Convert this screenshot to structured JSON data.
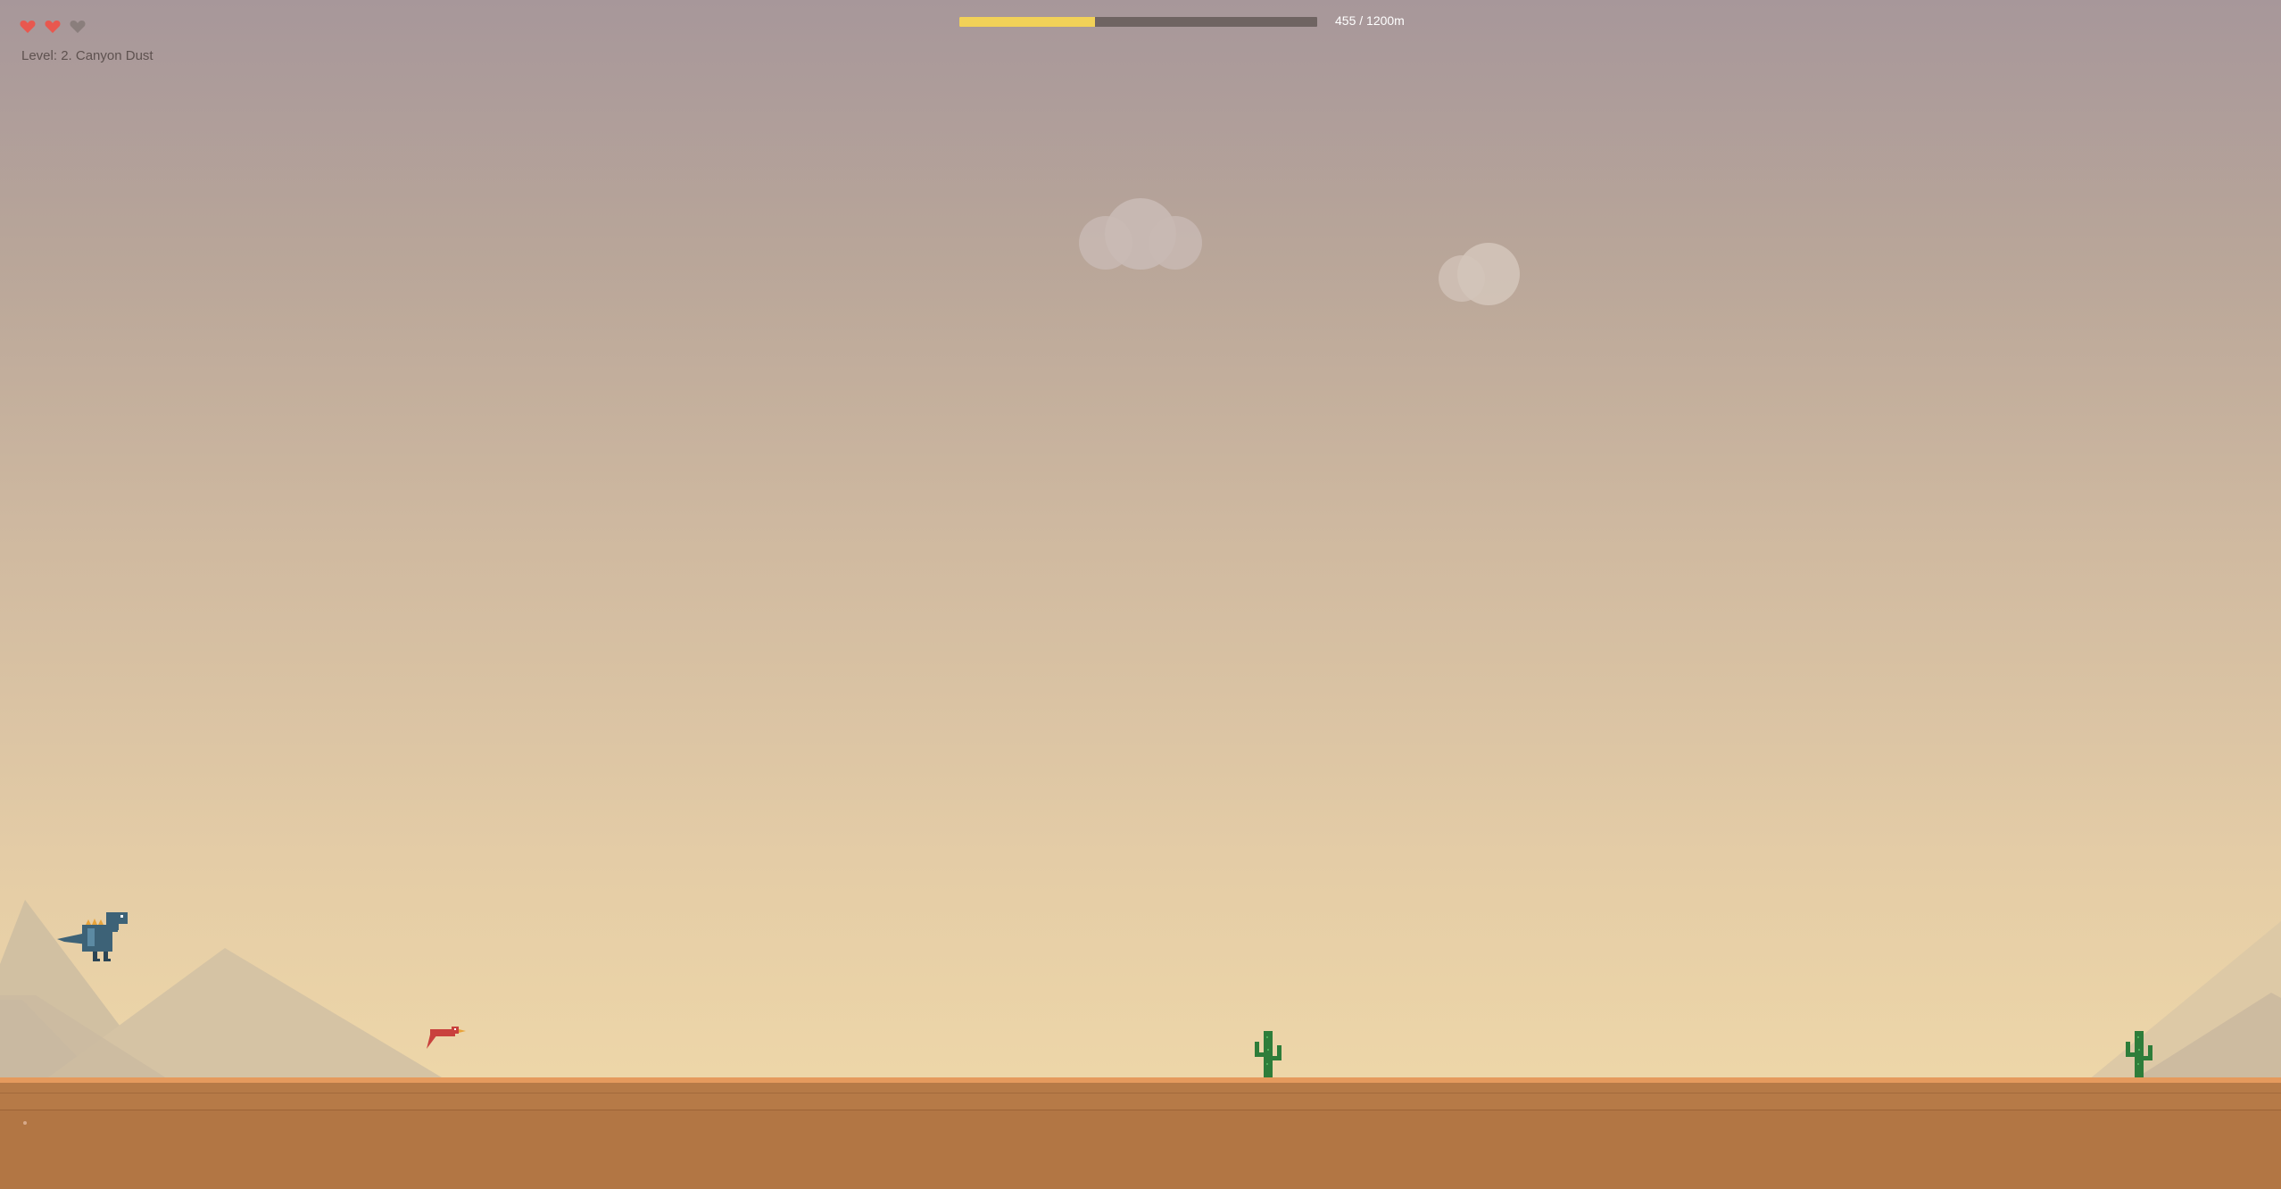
{
  "hud": {
    "lives_total": 3,
    "lives_remaining": 2,
    "heart_icon": "heart-icon",
    "level_label": "Level: 2. Canyon Dust",
    "progress": {
      "current": 455,
      "total": 1200,
      "label": "455 / 1200m"
    }
  },
  "colors": {
    "heart_full": "#e8584f",
    "heart_empty": "#8a7e7c",
    "progress_fill": "#f1d158",
    "progress_track": "#6f6462",
    "sky_top": "#a7979a",
    "sky_bottom": "#f2dba9",
    "ground": "#b27644",
    "ground_edge": "#e59a5d",
    "cactus": "#2e7d3a",
    "dino": "#3d6277",
    "dino_spikes": "#e8a33a",
    "bird": "#c9413d"
  },
  "scene": {
    "player": "dinosaur-icon",
    "obstacles": [
      "bird-icon",
      "cactus-icon",
      "cactus-icon"
    ],
    "decor": [
      "cloud",
      "cloud",
      "mountain-range"
    ]
  }
}
